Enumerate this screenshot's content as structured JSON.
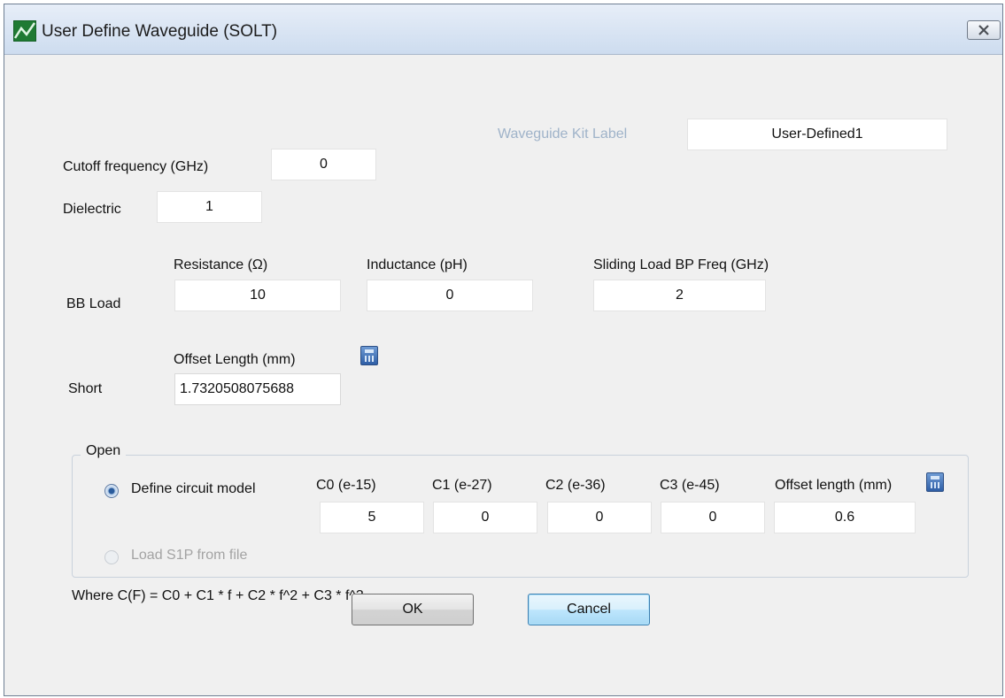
{
  "window": {
    "title": "User Define Waveguide (SOLT)"
  },
  "kit": {
    "label": "Waveguide Kit Label",
    "value": "User-Defined1"
  },
  "cutoff": {
    "label": "Cutoff frequency (GHz)",
    "value": "0"
  },
  "dielectric": {
    "label": "Dielectric",
    "value": "1"
  },
  "bb_load": {
    "label": "BB Load",
    "resistance_label": "Resistance (Ω)",
    "resistance_value": "10",
    "inductance_label": "Inductance (pH)",
    "inductance_value": "0",
    "sliding_label": "Sliding Load BP Freq (GHz)",
    "sliding_value": "2"
  },
  "short": {
    "label": "Short",
    "offset_label": "Offset Length (mm)",
    "offset_value": "1.7320508075688"
  },
  "open": {
    "group_title": "Open",
    "define_label": "Define circuit model",
    "load_label": "Load S1P from file",
    "selected": "Define circuit model",
    "c0_label": "C0 (e-15)",
    "c0_value": "5",
    "c1_label": "C1 (e-27)",
    "c1_value": "0",
    "c2_label": "C2 (e-36)",
    "c2_value": "0",
    "c3_label": "C3 (e-45)",
    "c3_value": "0",
    "offset_label": "Offset length (mm)",
    "offset_value": "0.6"
  },
  "formula": "Where C(F) = C0 + C1 * f + C2 * f^2 + C3 * f^3",
  "buttons": {
    "ok": "OK",
    "cancel": "Cancel"
  },
  "icons": {
    "app": "network-analyzer-icon",
    "close": "close-icon",
    "calculator": "calculator-icon"
  }
}
